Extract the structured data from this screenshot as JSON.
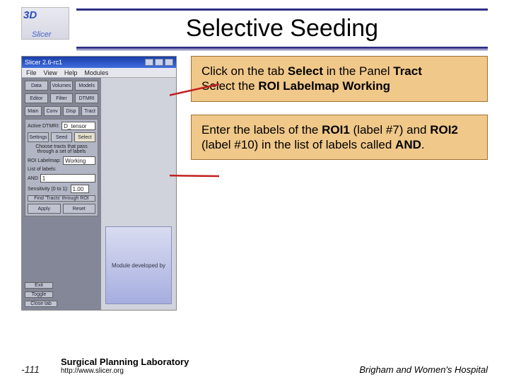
{
  "header": {
    "logo_top": "3D",
    "logo_bottom": "Slicer",
    "title": "Selective Seeding"
  },
  "screenshot": {
    "window_title": "Slicer 2.6-rc1",
    "menus": [
      "File",
      "View",
      "Help",
      "Modules"
    ],
    "top_buttons_row1": [
      "Data",
      "Volumes",
      "Models"
    ],
    "top_buttons_row2": [
      "Editor",
      "Filter",
      "DTMRI"
    ],
    "nav_tabs": [
      "Main",
      "Conv",
      "Disp",
      "Tract"
    ],
    "active_dtmri_label": "Active DTMRI:",
    "active_dtmri_value": "D_tensor",
    "tract_tabs": [
      "Settings",
      "Seed",
      "Select"
    ],
    "select_hint": "Choose tracts that pass through a set of labels",
    "roi_label": "ROI Labelmap:",
    "roi_value": "Working",
    "list_label": "List of labels:",
    "and_label": "AND",
    "and_value": "1",
    "sensitivity_label": "Sensitivity (0 to 1):",
    "sensitivity_value": "1.00",
    "find_button": "Find 'Tracts' through ROI",
    "apply_button": "Apply",
    "reset_button": "Reset",
    "exit_button": "Exit",
    "toggle_button": "Toggle",
    "close_button": "Close tab",
    "dev_caption": "Module developed by"
  },
  "callouts": {
    "c1_p1a": "Click on the tab ",
    "c1_p1b": "Select",
    "c1_p1c": " in the Panel ",
    "c1_p1d": "Tract",
    "c1_p2a": "Select the ",
    "c1_p2b": "ROI Labelmap Working",
    "c2_p1a": "Enter the labels of the  ",
    "c2_p1b": "ROI1",
    "c2_p1c": " (label #7) and ",
    "c2_p1d": "ROI2",
    "c2_p1e": " (label #10) in the list of labels called ",
    "c2_p1f": "AND",
    "c2_p1g": "."
  },
  "footer": {
    "page": "-111",
    "lab": "Surgical Planning Laboratory",
    "url": "http://www.slicer.org",
    "hospital": "Brigham and Women's Hospital"
  }
}
